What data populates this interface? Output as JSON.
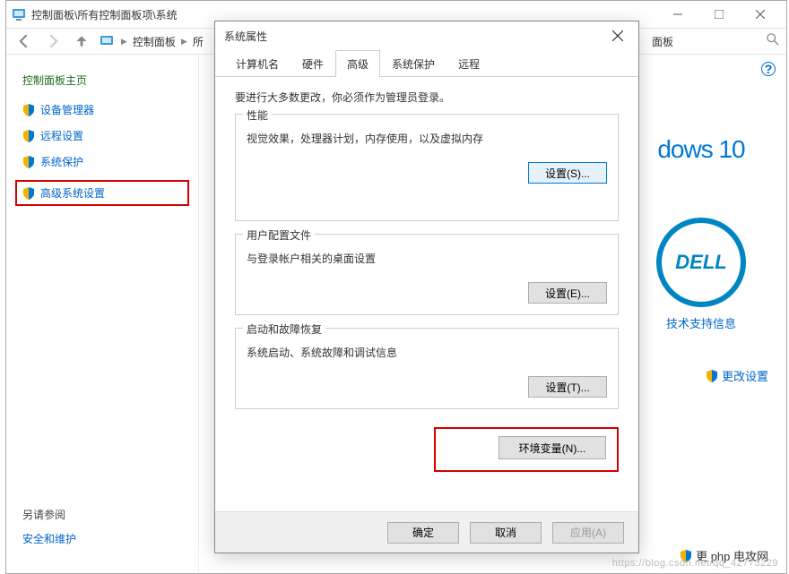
{
  "window": {
    "title": "控制面板\\所有控制面板项\\系统",
    "breadcrumb": {
      "item0": "控制面板",
      "item1": "所",
      "addr_label": "面板"
    }
  },
  "sidebar": {
    "title": "控制面板主页",
    "items": [
      {
        "label": "设备管理器"
      },
      {
        "label": "远程设置"
      },
      {
        "label": "系统保护"
      },
      {
        "label": "高级系统设置"
      }
    ]
  },
  "see_also": {
    "title": "另请参阅",
    "link": "安全和维护"
  },
  "right_panel": {
    "windows_logo": "dows 10",
    "dell": "DELL",
    "support": "技术支持信息",
    "change": "更改设置",
    "bottom_change": "更 php 电攻网"
  },
  "dialog": {
    "title": "系统属性",
    "tabs": [
      {
        "label": "计算机名"
      },
      {
        "label": "硬件"
      },
      {
        "label": "高级"
      },
      {
        "label": "系统保护"
      },
      {
        "label": "远程"
      }
    ],
    "intro": "要进行大多数更改，你必须作为管理员登录。",
    "groups": {
      "performance": {
        "title": "性能",
        "desc": "视觉效果，处理器计划，内存使用，以及虚拟内存",
        "button": "设置(S)..."
      },
      "profiles": {
        "title": "用户配置文件",
        "desc": "与登录帐户相关的桌面设置",
        "button": "设置(E)..."
      },
      "recovery": {
        "title": "启动和故障恢复",
        "desc": "系统启动、系统故障和调试信息",
        "button": "设置(T)..."
      }
    },
    "env_button": "环境变量(N)...",
    "footer": {
      "ok": "确定",
      "cancel": "取消",
      "apply": "应用(A)"
    }
  },
  "watermark": "https://blog.csdn.net/qq_42773229"
}
